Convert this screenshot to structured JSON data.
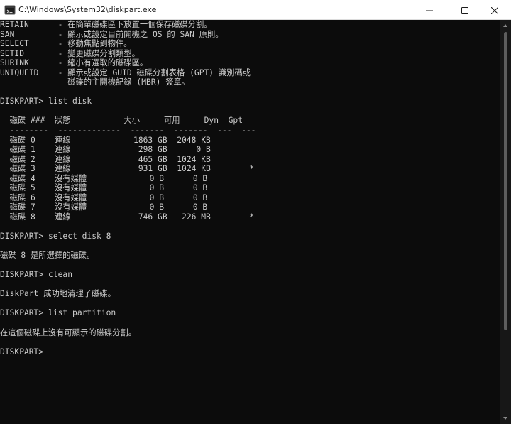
{
  "window": {
    "title": "C:\\Windows\\System32\\diskpart.exe",
    "icon": "console-app-icon",
    "controls": {
      "minimize_icon": "minimize-icon",
      "maximize_icon": "maximize-icon",
      "close_icon": "close-icon"
    }
  },
  "colors": {
    "terminal_background": "#0c0c0c",
    "terminal_text": "#cccccc",
    "titlebar_background": "#ffffff"
  },
  "terminal": {
    "lines": [
      "RETAIN      - 在簡單磁碟區下放置一個保存磁碟分割。",
      "SAN         - 顯示或設定目前開機之 OS 的 SAN 原則。",
      "SELECT      - 移動焦點到物件。",
      "SETID       - 變更磁碟分割類型。",
      "SHRINK      - 縮小有選取的磁碟區。",
      "UNIQUEID    - 顯示或設定 GUID 磁碟分割表格 (GPT) 識別碼或",
      "              磁碟的主開機記錄 (MBR) 簽章。",
      "",
      "DISKPART> list disk",
      "",
      "  磁碟 ###  狀態           大小     可用     Dyn  Gpt",
      "  --------  -------------  -------  -------  ---  ---",
      "  磁碟 0    連線             1863 GB  2048 KB",
      "  磁碟 1    連線              298 GB      0 B",
      "  磁碟 2    連線              465 GB  1024 KB",
      "  磁碟 3    連線              931 GB  1024 KB        *",
      "  磁碟 4    沒有媒體             0 B      0 B",
      "  磁碟 5    沒有媒體             0 B      0 B",
      "  磁碟 6    沒有媒體             0 B      0 B",
      "  磁碟 7    沒有媒體             0 B      0 B",
      "  磁碟 8    連線              746 GB   226 MB        *",
      "",
      "DISKPART> select disk 8",
      "",
      "磁碟 8 是所選擇的磁碟。",
      "",
      "DISKPART> clean",
      "",
      "DiskPart 成功地清理了磁碟。",
      "",
      "DISKPART> list partition",
      "",
      "在這個磁碟上沒有可顯示的磁碟分割。",
      "",
      "DISKPART>"
    ]
  }
}
